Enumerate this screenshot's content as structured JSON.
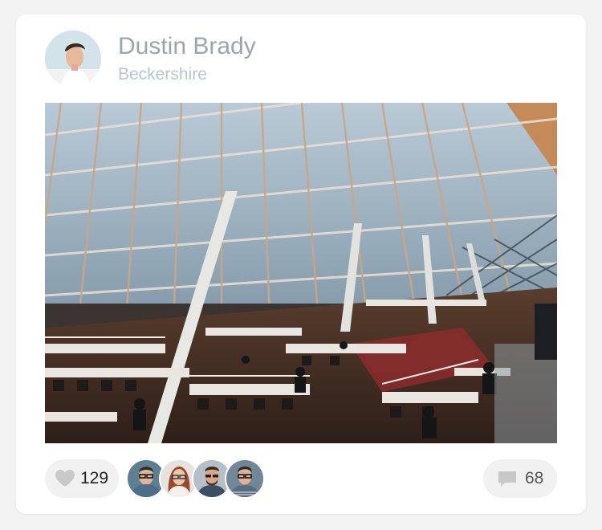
{
  "post": {
    "author": {
      "name": "Dustin Brady",
      "location": "Beckershire"
    },
    "photo": {
      "subject": "library-interior"
    },
    "likes": {
      "count": "129",
      "icon": "heart-icon"
    },
    "likers": [
      {
        "id": "liker-1",
        "shirt": "#4a6f8a",
        "hair": "#2b2b2b",
        "bg": "#5d7f93"
      },
      {
        "id": "liker-2",
        "shirt": "#e9e2d8",
        "hair": "#9a4a2c",
        "bg": "#e8e2dc"
      },
      {
        "id": "liker-3",
        "shirt": "#3b4e63",
        "hair": "#3a2a1e",
        "bg": "#b4bfc6"
      },
      {
        "id": "liker-4",
        "shirt": "#5a6d7e",
        "hair": "#2f2722",
        "bg": "#6f8796"
      }
    ],
    "comments": {
      "count": "68",
      "icon": "comment-icon"
    }
  },
  "colors": {
    "name": "#9aa6ad",
    "location": "#b8c7cd",
    "pill": "#f1f1f1",
    "icon": "#c9c9c9"
  }
}
